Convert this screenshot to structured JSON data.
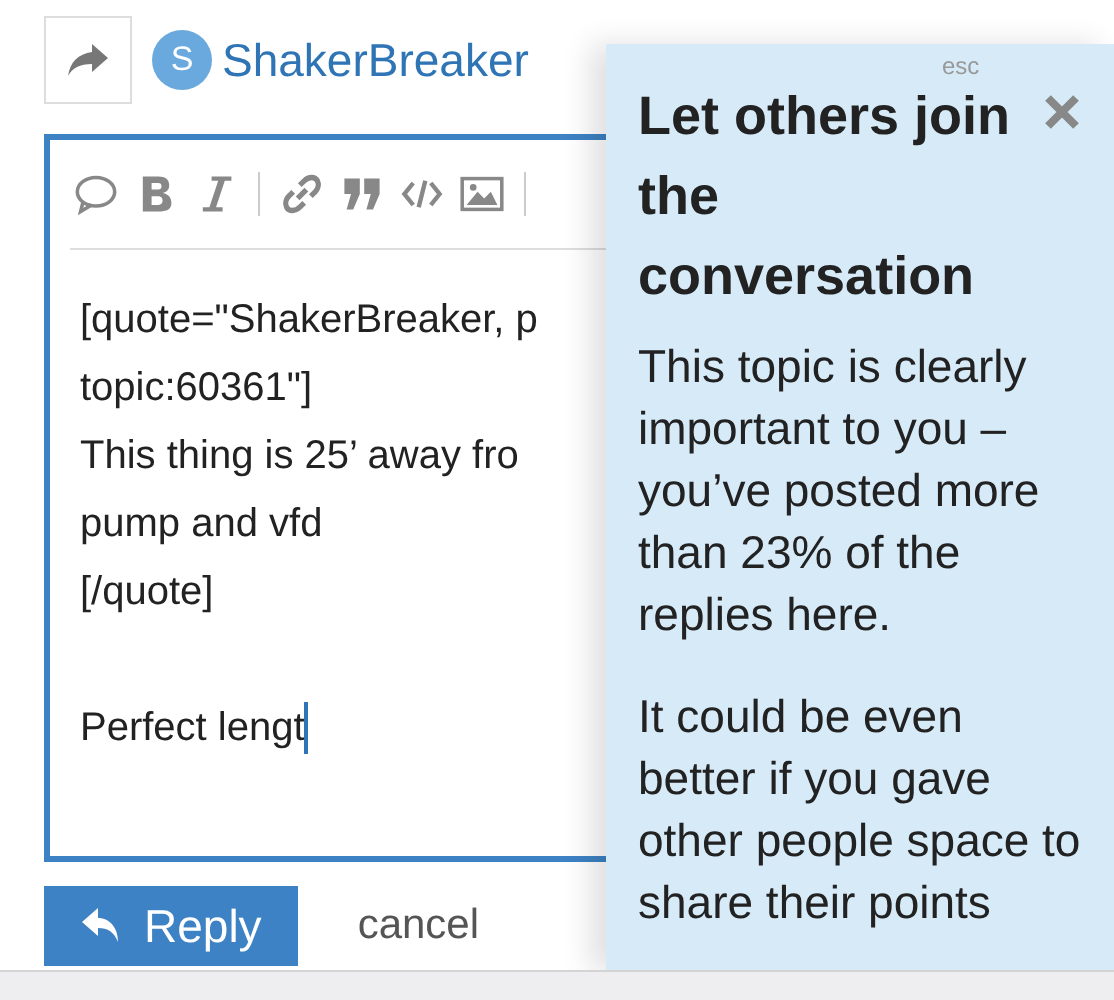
{
  "composer": {
    "user": {
      "initial": "S",
      "name": "ShakerBreaker"
    },
    "toolbar": [
      {
        "kind": "quote-bubble"
      },
      {
        "kind": "bold"
      },
      {
        "kind": "italic"
      },
      {
        "kind": "divider"
      },
      {
        "kind": "link"
      },
      {
        "kind": "blockquote"
      },
      {
        "kind": "code"
      },
      {
        "kind": "image"
      },
      {
        "kind": "divider"
      }
    ],
    "paragraphs": [
      [
        "[quote=\"ShakerBreaker, p",
        "topic:60361\"]",
        "This thing is 25’ away fro",
        "pump and vfd",
        "[/quote]"
      ],
      [
        "Perfect lengt"
      ]
    ],
    "buttons": [
      {
        "kind": "primary",
        "label": "Reply"
      },
      {
        "kind": "link",
        "label": "cancel"
      }
    ]
  },
  "popup": {
    "hint": "esc",
    "title": "Let others join the conversation",
    "paragraphs": [
      "This topic is clearly important to you – you’ve posted more than 23% of the replies here.",
      "It could be even better if you gave other people space to share their points"
    ]
  }
}
